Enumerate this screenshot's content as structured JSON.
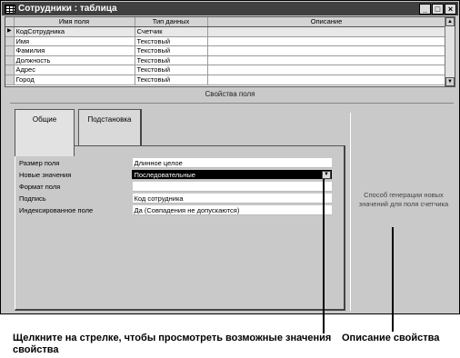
{
  "window": {
    "title": "Сотрудники : таблица"
  },
  "window_buttons": {
    "minimize": "_",
    "maximize": "□",
    "close": "×"
  },
  "grid": {
    "headers": [
      "Имя поля",
      "Тип данных",
      "Описание"
    ],
    "rows": [
      {
        "marker": "▶",
        "name": "КодСотрудника",
        "type": "Счетчик",
        "desc": ""
      },
      {
        "marker": "",
        "name": "Имя",
        "type": "Текстовый",
        "desc": ""
      },
      {
        "marker": "",
        "name": "Фамилия",
        "type": "Текстовый",
        "desc": ""
      },
      {
        "marker": "",
        "name": "Должность",
        "type": "Текстовый",
        "desc": ""
      },
      {
        "marker": "",
        "name": "Адрес",
        "type": "Текстовый",
        "desc": ""
      },
      {
        "marker": "",
        "name": "Город",
        "type": "Текстовый",
        "desc": ""
      }
    ]
  },
  "props_section": {
    "label": "Свойства поля"
  },
  "tabs": {
    "general": "Общие",
    "substitution": "Подстановка"
  },
  "properties": [
    {
      "label": "Размер поля",
      "value": "Длинное целое"
    },
    {
      "label": "Новые значения",
      "value": "Последовательные"
    },
    {
      "label": "Формат поля",
      "value": ""
    },
    {
      "label": "Подпись",
      "value": "Код сотрудника"
    },
    {
      "label": "Индексированное поле",
      "value": "Да (Совпадения не допускаются)"
    }
  ],
  "description": "Способ генерации новых значений для поля счетчика",
  "callouts": {
    "dropdown": "Щелкните на стрелке, чтобы просмотреть возможные значения свойства",
    "description": "Описание свойства"
  },
  "icons": {
    "app": "table-icon",
    "dropdown": "chevron-down-icon",
    "current_row": "row-pointer-icon"
  }
}
